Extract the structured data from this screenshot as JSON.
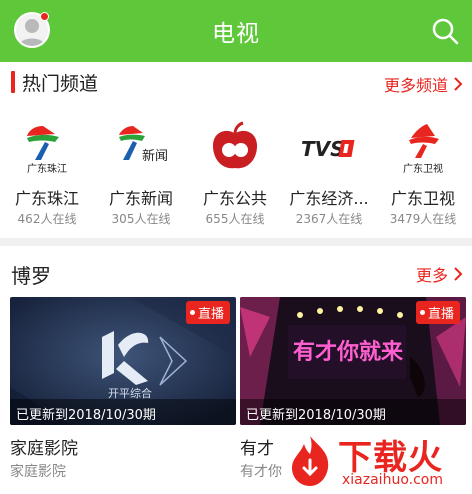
{
  "header": {
    "title": "电视"
  },
  "hot": {
    "title": "热门频道",
    "more": "更多频道",
    "channels": [
      {
        "logo_text": "广东珠江",
        "name": "广东珠江",
        "count": "462人在线"
      },
      {
        "logo_text": "新闻",
        "name": "广东新闻",
        "count": "305人在线"
      },
      {
        "logo_text": "",
        "name": "广东公共",
        "count": "655人在线"
      },
      {
        "logo_text": "TVS",
        "name": "广东经济...",
        "count": "2367人在线"
      },
      {
        "logo_text": "广东卫视",
        "name": "广东卫视",
        "count": "3479人在线"
      }
    ]
  },
  "boluo": {
    "title": "博罗",
    "more": "更多",
    "cards": [
      {
        "badge": "直播",
        "thumb_text": "开平综合",
        "update": "已更新到2018/10/30期",
        "title": "家庭影院",
        "subtitle": "家庭影院"
      },
      {
        "badge": "直播",
        "thumb_text": "有才你就来",
        "update": "已更新到2018/10/30期",
        "title": "有才",
        "subtitle": "有才你"
      }
    ]
  },
  "watermark": {
    "text": "下载火",
    "url": "xiazaihuo.com"
  },
  "colors": {
    "brand_green": "#5fc83a",
    "accent_red": "#e8261f"
  }
}
